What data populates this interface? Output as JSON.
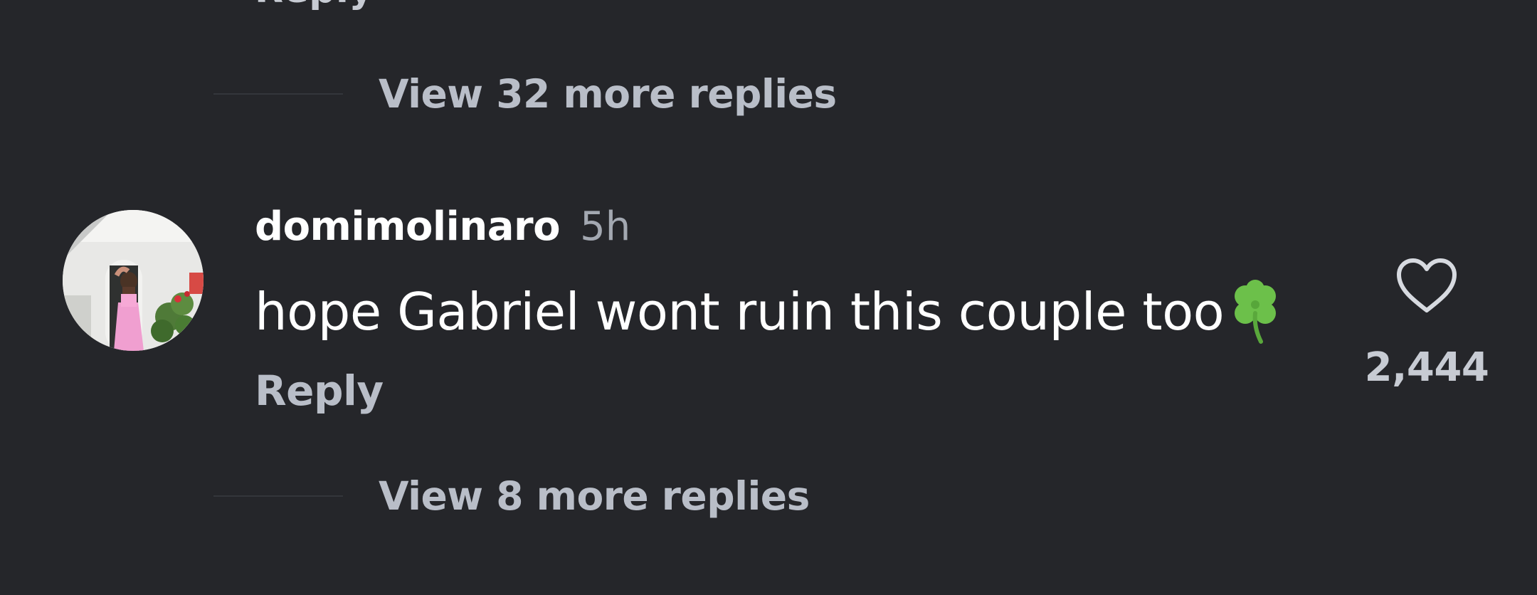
{
  "thread": {
    "partial_reply_label": "Reply",
    "view_more_top": "View 32 more replies",
    "view_more_bottom": "View 8 more replies"
  },
  "comment": {
    "username": "domimolinaro",
    "timestamp": "5h",
    "text": "hope Gabriel wont ruin this couple too",
    "emoji_icon": "four-leaf-clover-icon",
    "reply_label": "Reply",
    "like_count": "2,444",
    "like_icon": "heart-outline-icon"
  },
  "colors": {
    "background": "#25262a",
    "primary_text": "#ffffff",
    "secondary_text": "#b9bec8",
    "timestamp": "#a3a8b1",
    "clover": "#6cc04a"
  }
}
